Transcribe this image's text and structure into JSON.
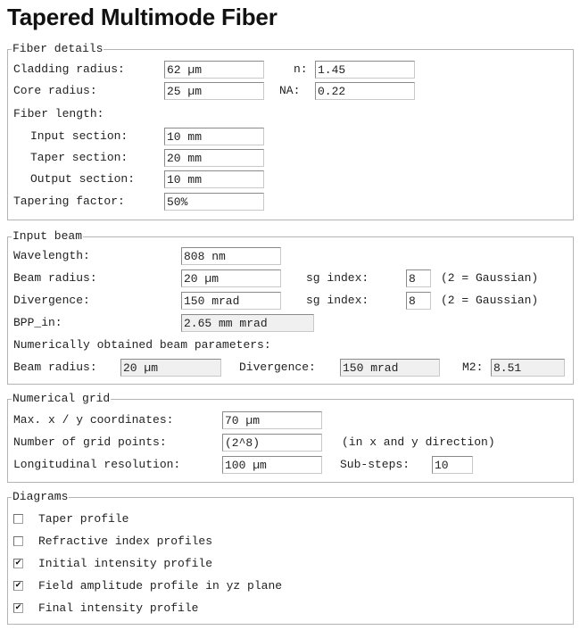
{
  "page": {
    "title": "Tapered Multimode Fiber"
  },
  "fiber": {
    "legend": "Fiber details",
    "cladding_label": "Cladding radius:",
    "cladding_value": "62 µm",
    "n_label": "n:",
    "n_value": "1.45",
    "core_label": "Core radius:",
    "core_value": "25 µm",
    "na_label": "NA:",
    "na_value": "0.22",
    "length_label": "Fiber length:",
    "input_label": "Input section:",
    "input_value": "10 mm",
    "taper_label": "Taper section:",
    "taper_value": "20 mm",
    "output_label": "Output section:",
    "output_value": "10 mm",
    "tapering_label": "Tapering factor:",
    "tapering_value": "50%"
  },
  "beam": {
    "legend": "Input beam",
    "wavelength_label": "Wavelength:",
    "wavelength_value": "808 nm",
    "radius_label": "Beam radius:",
    "radius_value": "20 µm",
    "sg1_label": "sg index:",
    "sg1_value": "8",
    "sg1_note": "(2 = Gaussian)",
    "divergence_label": "Divergence:",
    "divergence_value": "150 mrad",
    "sg2_label": "sg index:",
    "sg2_value": "8",
    "sg2_note": "(2 = Gaussian)",
    "bpp_label": "BPP_in:",
    "bpp_value": "2.65 mm mrad",
    "numerical_heading": "Numerically obtained beam parameters:",
    "num_radius_label": "Beam radius:",
    "num_radius_value": "20 µm",
    "num_divergence_label": "Divergence:",
    "num_divergence_value": "150 mrad",
    "m2_label": "M2:",
    "m2_value": "8.51"
  },
  "grid": {
    "legend": "Numerical grid",
    "maxxy_label": "Max. x / y coordinates:",
    "maxxy_value": "70 µm",
    "points_label": "Number of grid points:",
    "points_value": "(2^8)",
    "points_note": "(in x and y direction)",
    "long_label": "Longitudinal resolution:",
    "long_value": "100 µm",
    "substeps_label": "Sub-steps:",
    "substeps_value": "10"
  },
  "diagrams": {
    "legend": "Diagrams",
    "items": [
      {
        "label": "Taper profile",
        "checked": false
      },
      {
        "label": "Refractive index profiles",
        "checked": false
      },
      {
        "label": "Initial intensity profile",
        "checked": true
      },
      {
        "label": "Field amplitude profile in yz plane",
        "checked": true
      },
      {
        "label": "Final intensity profile",
        "checked": true
      }
    ],
    "check_glyph": "✔"
  }
}
